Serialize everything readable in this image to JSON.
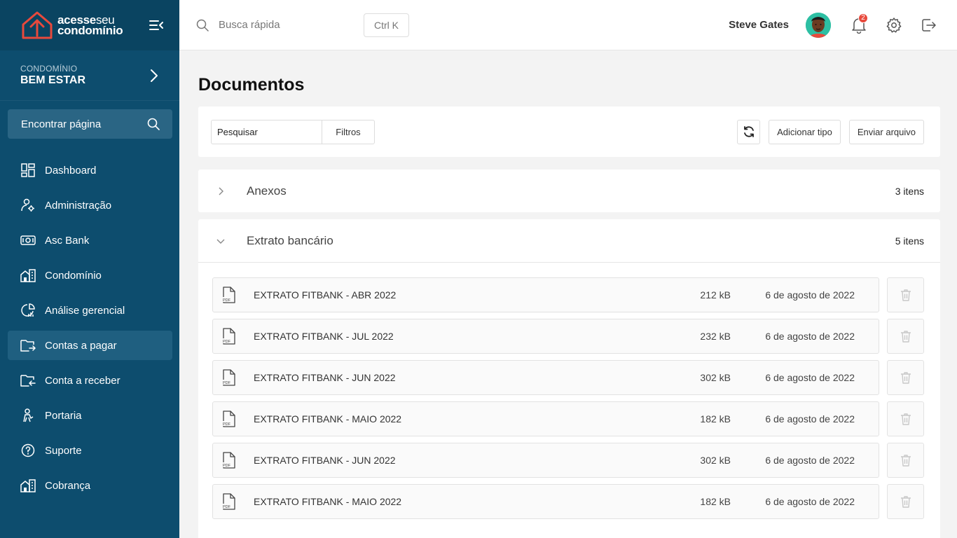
{
  "brand": {
    "line1": "acesse",
    "line1_thin": "seu",
    "line2": "condomínio"
  },
  "condo": {
    "label": "CONDOMÍNIO",
    "name": "BEM ESTAR"
  },
  "find_page": {
    "label": "Encontrar página"
  },
  "nav": [
    {
      "label": "Dashboard",
      "icon": "dashboard-icon"
    },
    {
      "label": "Administração",
      "icon": "admin-gear-icon"
    },
    {
      "label": "Asc Bank",
      "icon": "bank-icon"
    },
    {
      "label": "Condomínio",
      "icon": "building-icon"
    },
    {
      "label": "Análise gerencial",
      "icon": "analytics-icon"
    },
    {
      "label": "Contas a pagar",
      "icon": "folder-out-icon",
      "active": true
    },
    {
      "label": "Conta a receber",
      "icon": "folder-in-icon"
    },
    {
      "label": "Portaria",
      "icon": "doorman-icon"
    },
    {
      "label": "Suporte",
      "icon": "help-icon"
    },
    {
      "label": "Cobrança",
      "icon": "building-icon"
    }
  ],
  "topbar": {
    "search_placeholder": "Busca rápida",
    "shortcut": "Ctrl K",
    "user_name": "Steve Gates",
    "notification_count": "2"
  },
  "page": {
    "title": "Documentos"
  },
  "toolbar": {
    "search_placeholder": "Pesquisar",
    "filters_label": "Filtros",
    "add_type_label": "Adicionar tipo",
    "upload_label": "Enviar arquivo"
  },
  "groups": [
    {
      "name": "Anexos",
      "count": "3 itens",
      "expanded": false
    },
    {
      "name": "Extrato bancário",
      "count": "5 itens",
      "expanded": true,
      "files": [
        {
          "name": "EXTRATO FITBANK - ABR 2022",
          "size": "212 kB",
          "date": "6 de agosto de 2022"
        },
        {
          "name": "EXTRATO FITBANK - JUL 2022",
          "size": "232 kB",
          "date": "6 de agosto de 2022"
        },
        {
          "name": "EXTRATO FITBANK - JUN 2022",
          "size": "302 kB",
          "date": "6 de agosto de 2022"
        },
        {
          "name": "EXTRATO FITBANK - MAIO 2022",
          "size": "182 kB",
          "date": "6 de agosto de 2022"
        },
        {
          "name": "EXTRATO FITBANK - JUN 2022",
          "size": "302 kB",
          "date": "6 de agosto de 2022"
        },
        {
          "name": "EXTRATO FITBANK - MAIO 2022",
          "size": "182 kB",
          "date": "6 de agosto de 2022"
        }
      ]
    }
  ],
  "colors": {
    "sidebar": "#0d4d6e",
    "logo_accent": "#e8493c",
    "badge": "#e8493c"
  }
}
